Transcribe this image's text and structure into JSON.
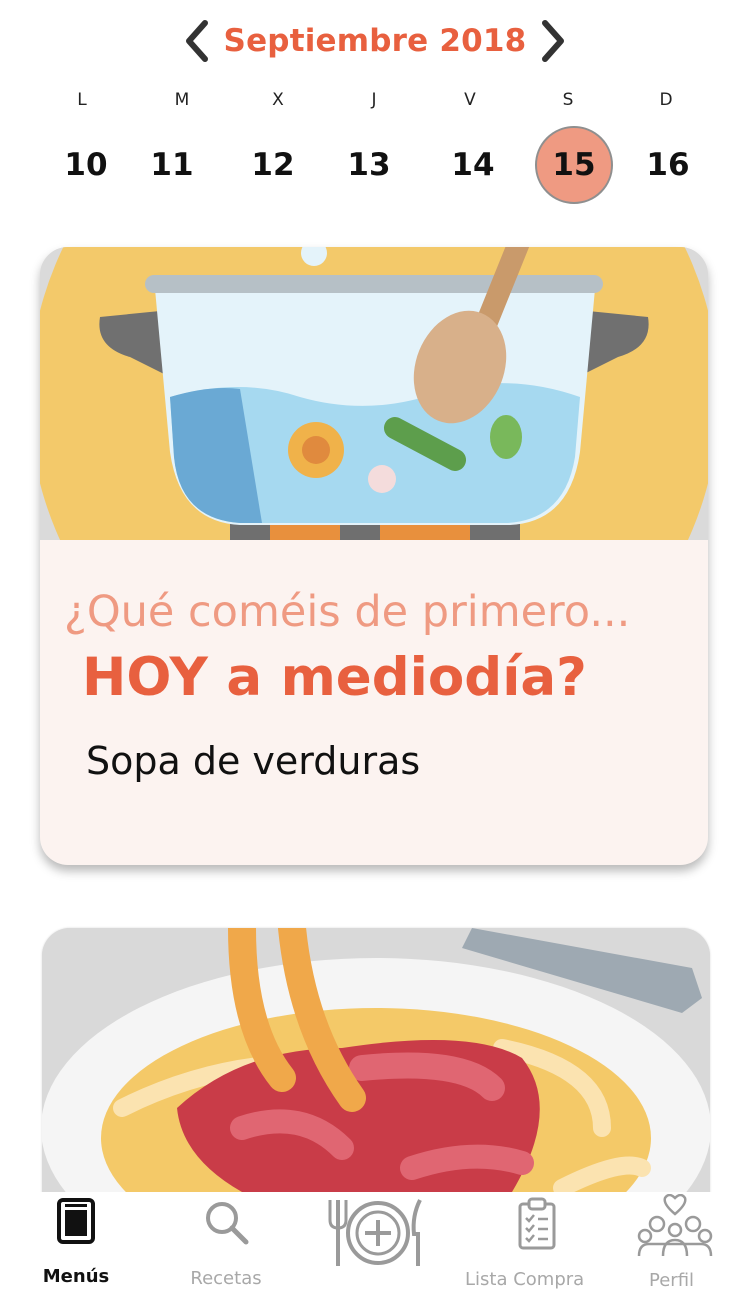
{
  "header": {
    "month_title": "Septiembre 2018",
    "prev_icon": "chevron-left-icon",
    "next_icon": "chevron-right-icon"
  },
  "weekdays": [
    "L",
    "M",
    "X",
    "J",
    "V",
    "S",
    "D"
  ],
  "days": [
    "10",
    "11",
    "12",
    "13",
    "14",
    "15",
    "16"
  ],
  "selected_day": "15",
  "colors": {
    "accent": "#e8603f",
    "accent_light": "#ef9a82",
    "card_bg": "#fcf3f0"
  },
  "card1": {
    "question_line1": "¿Qué coméis de primero...",
    "question_line2": "HOY a mediodía?",
    "meal": "Sopa de verduras",
    "image_icon": "soup-pot-icon"
  },
  "card2": {
    "image_icon": "spaghetti-plate-icon"
  },
  "bottom_nav": {
    "items": [
      {
        "label": "Menús",
        "icon": "menu-book-icon",
        "active": true
      },
      {
        "label": "Recetas",
        "icon": "search-icon",
        "active": false
      },
      {
        "label": "",
        "icon": "add-meal-icon",
        "active": false
      },
      {
        "label": "Lista Compra",
        "icon": "clipboard-checklist-icon",
        "active": false
      },
      {
        "label": "Perfil",
        "icon": "family-profile-icon",
        "active": false
      }
    ]
  }
}
